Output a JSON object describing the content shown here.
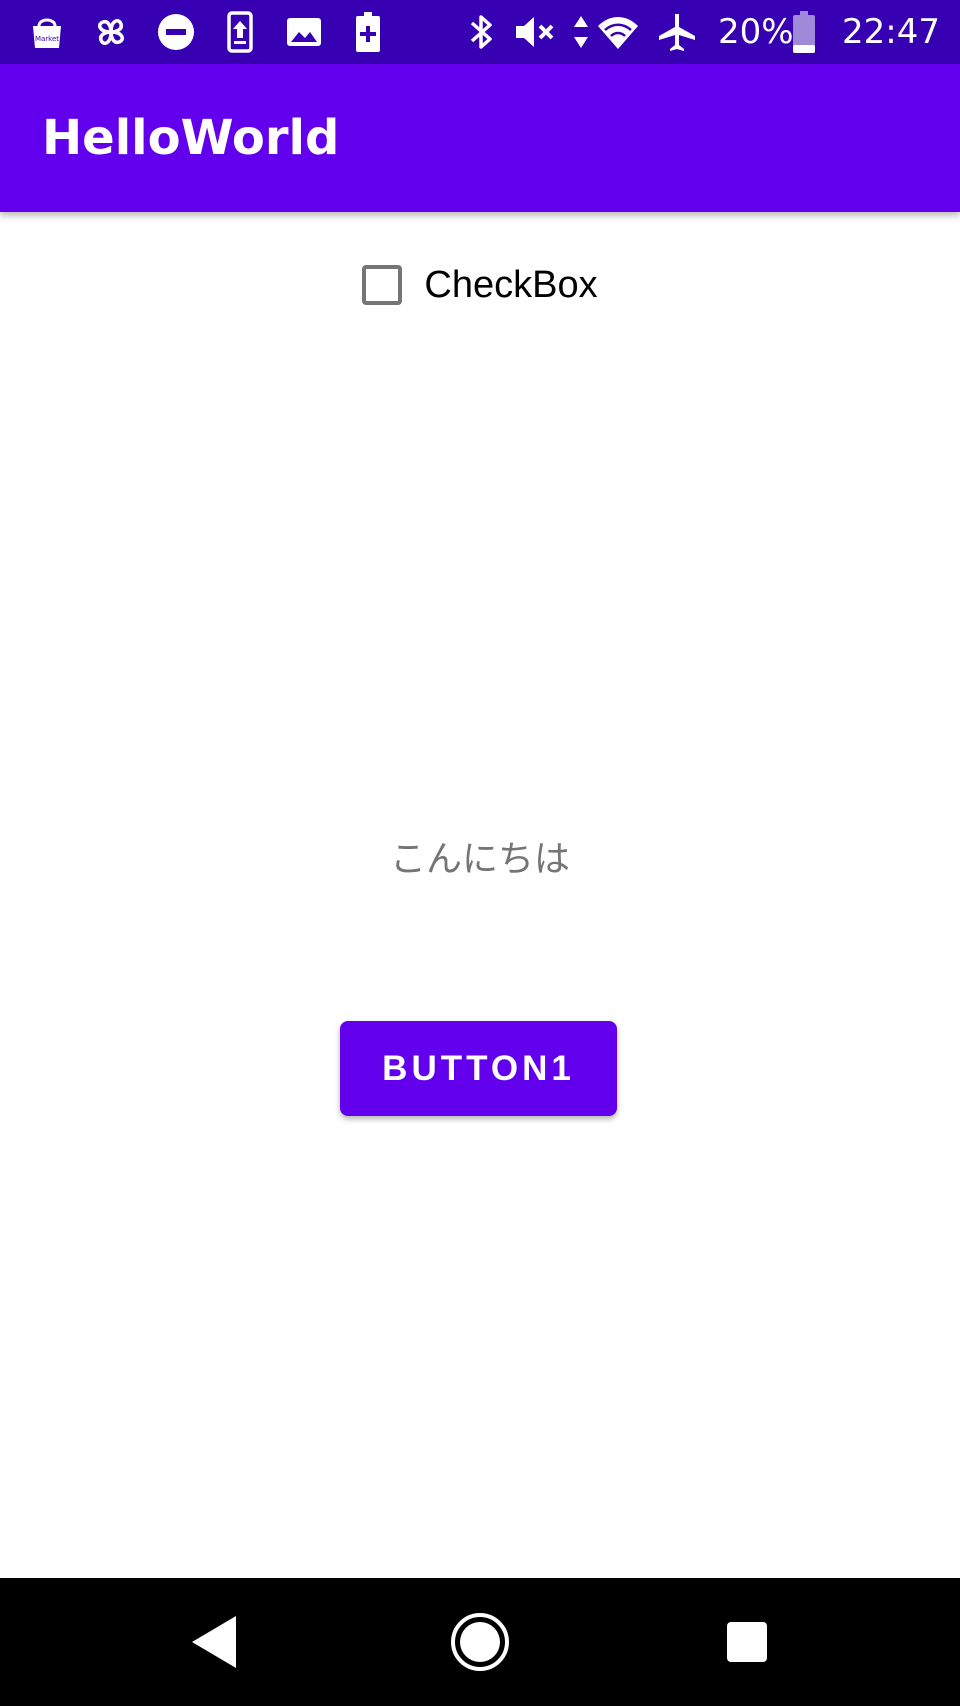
{
  "status_bar": {
    "battery_percent": "20%",
    "time": "22:47",
    "left_icons": [
      "market-icon",
      "pinwheel-icon",
      "do-not-disturb-icon",
      "phone-update-icon",
      "image-icon",
      "battery-charge-icon"
    ],
    "right_icons": [
      "bluetooth-icon",
      "volume-muted-icon",
      "data-arrows-icon",
      "wifi-icon",
      "airplane-icon",
      "battery-icon"
    ],
    "market_label": "Market"
  },
  "app_bar": {
    "title": "HelloWorld"
  },
  "checkbox": {
    "label": "CheckBox",
    "checked": false
  },
  "greeting": {
    "text": "こんにちは"
  },
  "button1": {
    "label": "BUTTON1"
  },
  "colors": {
    "status_bar": "#3700b3",
    "primary": "#6200ee",
    "nav_bar": "#000000",
    "greeting_text": "#757575"
  },
  "nav_bar": {
    "buttons": [
      "back-icon",
      "home-icon",
      "recents-icon"
    ]
  }
}
